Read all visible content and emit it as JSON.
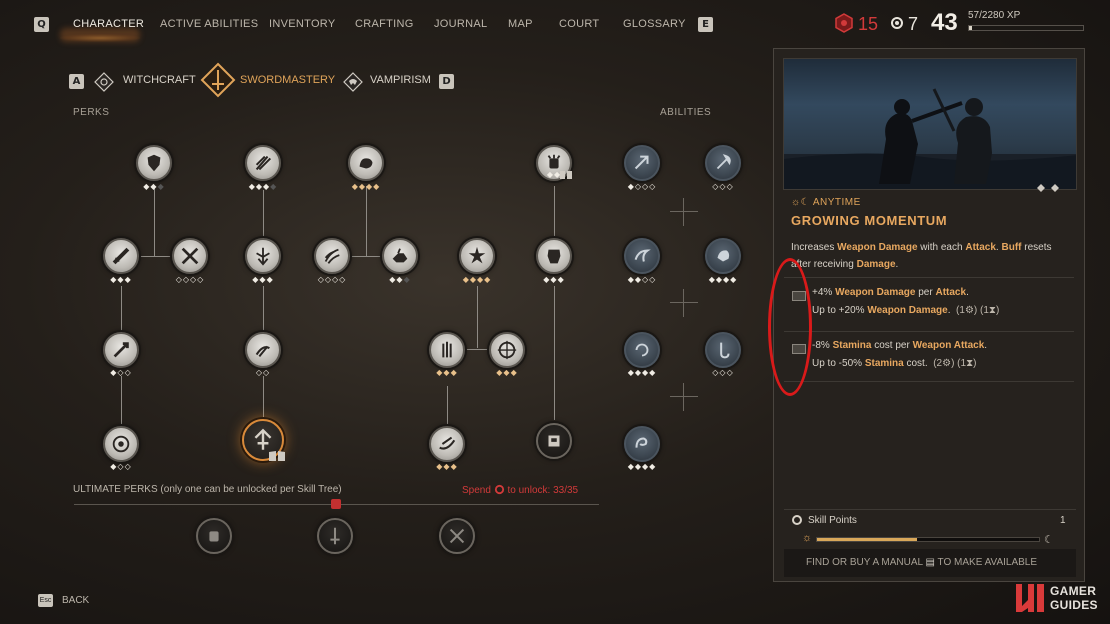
{
  "nav": {
    "left_key": "Q",
    "right_key": "E",
    "items": [
      {
        "label": "CHARACTER",
        "active": true
      },
      {
        "label": "ACTIVE ABILITIES",
        "active": false
      },
      {
        "label": "INVENTORY",
        "active": false
      },
      {
        "label": "CRAFTING",
        "active": false
      },
      {
        "label": "JOURNAL",
        "active": false
      },
      {
        "label": "MAP",
        "active": false
      },
      {
        "label": "COURT",
        "active": false
      },
      {
        "label": "GLOSSARY",
        "active": false
      }
    ]
  },
  "stats": {
    "red_value": "15",
    "white_value": "7",
    "level": "43",
    "xp_text": "57/2280 XP",
    "xp_fraction": 0.025
  },
  "tree_tabs": {
    "left_key": "A",
    "right_key": "D",
    "tabs": [
      {
        "label": "WITCHCRAFT",
        "active": false
      },
      {
        "label": "SWORDMASTERY",
        "active": true
      },
      {
        "label": "VAMPIRISM",
        "active": false
      }
    ]
  },
  "labels": {
    "perks": "PERKS",
    "abilities": "ABILITIES"
  },
  "ultimate": {
    "label": "ULTIMATE PERKS (only one can be unlocked per Skill Tree)",
    "spend_prefix": "Spend",
    "spend_suffix": "to unlock: 33/35"
  },
  "panel": {
    "anytime": "ANYTIME",
    "title": "GROWING MOMENTUM",
    "desc_parts": {
      "a": "Increases ",
      "b": "Weapon Damage",
      "c": " with each ",
      "d": "Attack",
      "e": ". ",
      "f": "Buff",
      "g": " resets after receiving ",
      "h": "Damage",
      "i": "."
    },
    "sub1": {
      "line1_a": "+4% ",
      "line1_b": "Weapon Damage",
      "line1_c": " per ",
      "line1_d": "Attack",
      "line1_e": ".",
      "line2_a": "Up to +20% ",
      "line2_b": "Weapon Damage",
      "line2_c": ".",
      "line2_d": "(1",
      "line2_e": ") (1",
      "line2_f": ")"
    },
    "sub2": {
      "line1_a": "-8% ",
      "line1_b": "Stamina",
      "line1_c": " cost per ",
      "line1_d": "Weapon Attack",
      "line1_e": ".",
      "line2_a": "Up to -50% ",
      "line2_b": "Stamina",
      "line2_c": " cost.",
      "line2_d": "(2",
      "line2_e": ") (1",
      "line2_f": ")"
    },
    "skill_points_label": "Skill Points",
    "skill_points_value": "1",
    "skill_progress": 0.45,
    "footer_a": "FIND OR BUY A MANUAL",
    "footer_b": "TO MAKE AVAILABLE"
  },
  "footer": {
    "esc_key": "Esc",
    "back_label": "BACK"
  },
  "watermark": {
    "line1": "GAMER",
    "line2": "GUIDES"
  }
}
